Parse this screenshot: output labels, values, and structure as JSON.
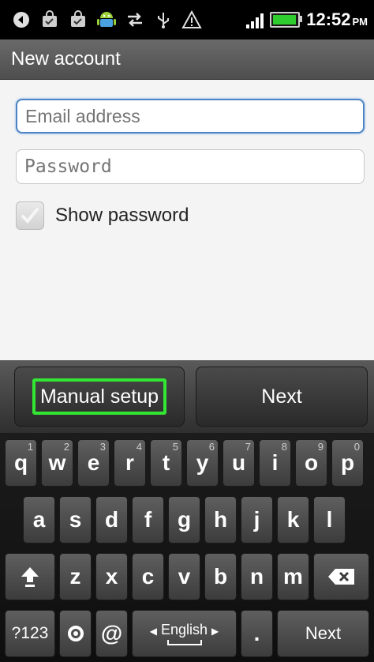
{
  "status_bar": {
    "time": "12:52",
    "ampm": "PM",
    "notification_icons": [
      "back-arrow-icon",
      "shopping-bag-icon",
      "shopping-bag-icon",
      "android-icon",
      "sync-icon",
      "usb-icon",
      "warning-icon"
    ],
    "battery_level": 0.85
  },
  "title_bar": {
    "title": "New account"
  },
  "form": {
    "email_placeholder": "Email address",
    "email_value": "",
    "password_placeholder": "Password",
    "password_value": "",
    "show_password_label": "Show password",
    "show_password_checked": false
  },
  "buttons": {
    "manual_setup": "Manual setup",
    "next": "Next"
  },
  "keyboard": {
    "row1": [
      {
        "label": "q",
        "num": "1"
      },
      {
        "label": "w",
        "num": "2"
      },
      {
        "label": "e",
        "num": "3"
      },
      {
        "label": "r",
        "num": "4"
      },
      {
        "label": "t",
        "num": "5"
      },
      {
        "label": "y",
        "num": "6"
      },
      {
        "label": "u",
        "num": "7"
      },
      {
        "label": "i",
        "num": "8"
      },
      {
        "label": "o",
        "num": "9"
      },
      {
        "label": "p",
        "num": "0"
      }
    ],
    "row2": [
      "a",
      "s",
      "d",
      "f",
      "g",
      "h",
      "j",
      "k",
      "l"
    ],
    "row3": [
      "z",
      "x",
      "c",
      "v",
      "b",
      "n",
      "m"
    ],
    "symbols_key": "?123",
    "at_key": "@",
    "language_label": "English",
    "period_key": ".",
    "enter_key": "Next"
  }
}
